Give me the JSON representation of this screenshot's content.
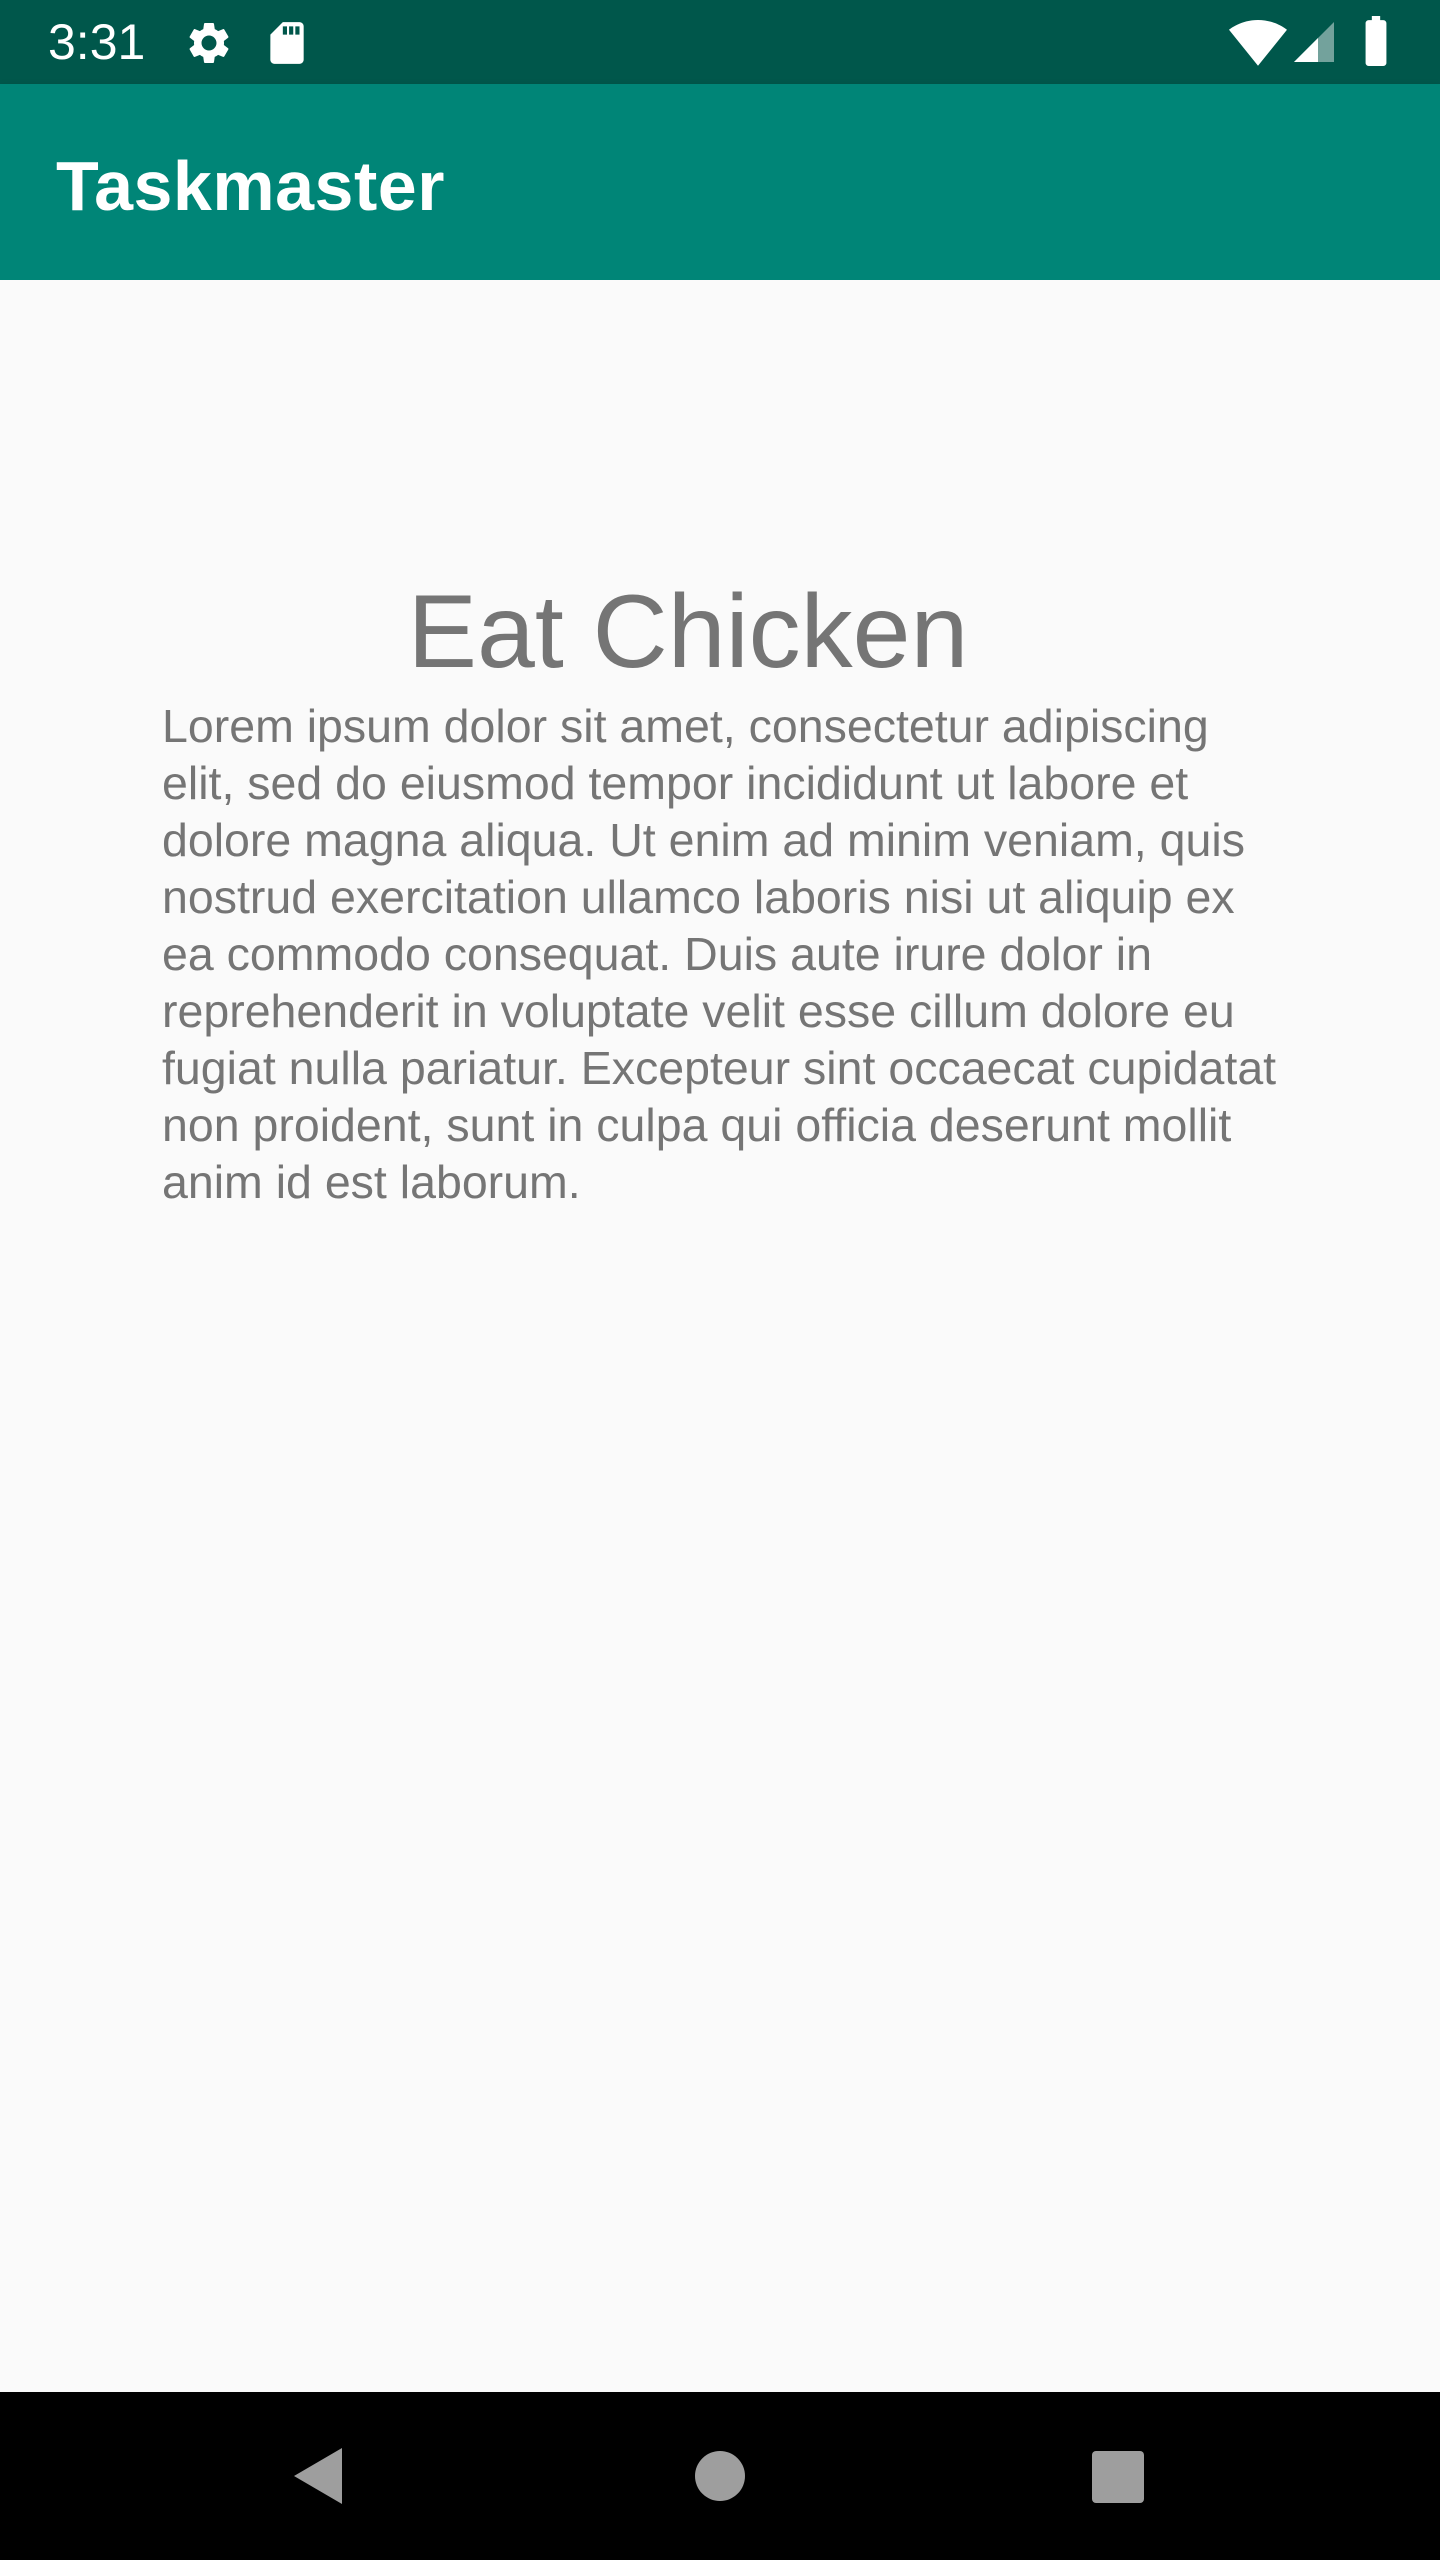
{
  "status_bar": {
    "time": "3:31",
    "icons": [
      "gear-icon",
      "sd-card-icon",
      "wifi-icon",
      "cell-signal-icon",
      "battery-icon"
    ],
    "background": "#00574B"
  },
  "app_bar": {
    "title": "Taskmaster",
    "background": "#008577"
  },
  "task": {
    "title": "Eat Chicken",
    "description": "Lorem ipsum dolor sit amet, consectetur adipiscing elit, sed do eiusmod tempor incididunt ut labore et dolore magna aliqua. Ut enim ad minim veniam, quis nostrud exercitation ullamco laboris nisi ut aliquip ex ea commodo consequat. Duis aute irure dolor in reprehenderit in voluptate velit esse cillum dolore eu fugiat nulla pariatur. Excepteur sint occaecat cupidatat non proident, sunt in culpa qui officia deserunt mollit anim id est laborum."
  },
  "nav_bar": {
    "buttons": [
      "back-icon",
      "home-icon",
      "recents-icon"
    ]
  }
}
